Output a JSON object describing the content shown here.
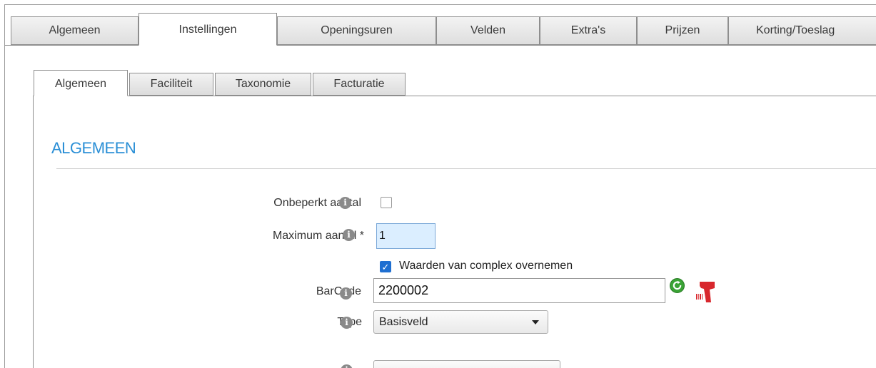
{
  "main_tabs": [
    {
      "label": "Algemeen",
      "active": false
    },
    {
      "label": "Instellingen",
      "active": true
    },
    {
      "label": "Openingsuren",
      "active": false
    },
    {
      "label": "Velden",
      "active": false
    },
    {
      "label": "Extra's",
      "active": false
    },
    {
      "label": "Prijzen",
      "active": false
    },
    {
      "label": "Korting/Toeslag",
      "active": false
    }
  ],
  "sub_tabs": [
    {
      "label": "Algemeen",
      "active": true
    },
    {
      "label": "Faciliteit",
      "active": false
    },
    {
      "label": "Taxonomie",
      "active": false
    },
    {
      "label": "Facturatie",
      "active": false
    }
  ],
  "section": {
    "title": "ALGEMEEN"
  },
  "form": {
    "unlimited": {
      "label": "Onbeperkt aantal",
      "checked": false
    },
    "max_count": {
      "label": "Maximum aantal *",
      "value": "1"
    },
    "copy_values": {
      "label": "Waarden van complex overnemen",
      "checked": true
    },
    "barcode": {
      "label": "BarCode",
      "value": "2200002"
    },
    "type": {
      "label": "Type",
      "value": "Basisveld"
    }
  },
  "colors": {
    "accent": "#2b8fd6",
    "checkbox_checked": "#1f6fd1",
    "refresh_icon": "#3aa335",
    "scanner_icon": "#d8272d"
  },
  "icons": {
    "info": "info-icon",
    "refresh": "refresh-icon",
    "scanner": "barcode-scanner-icon",
    "dropdown": "chevron-down-icon"
  }
}
